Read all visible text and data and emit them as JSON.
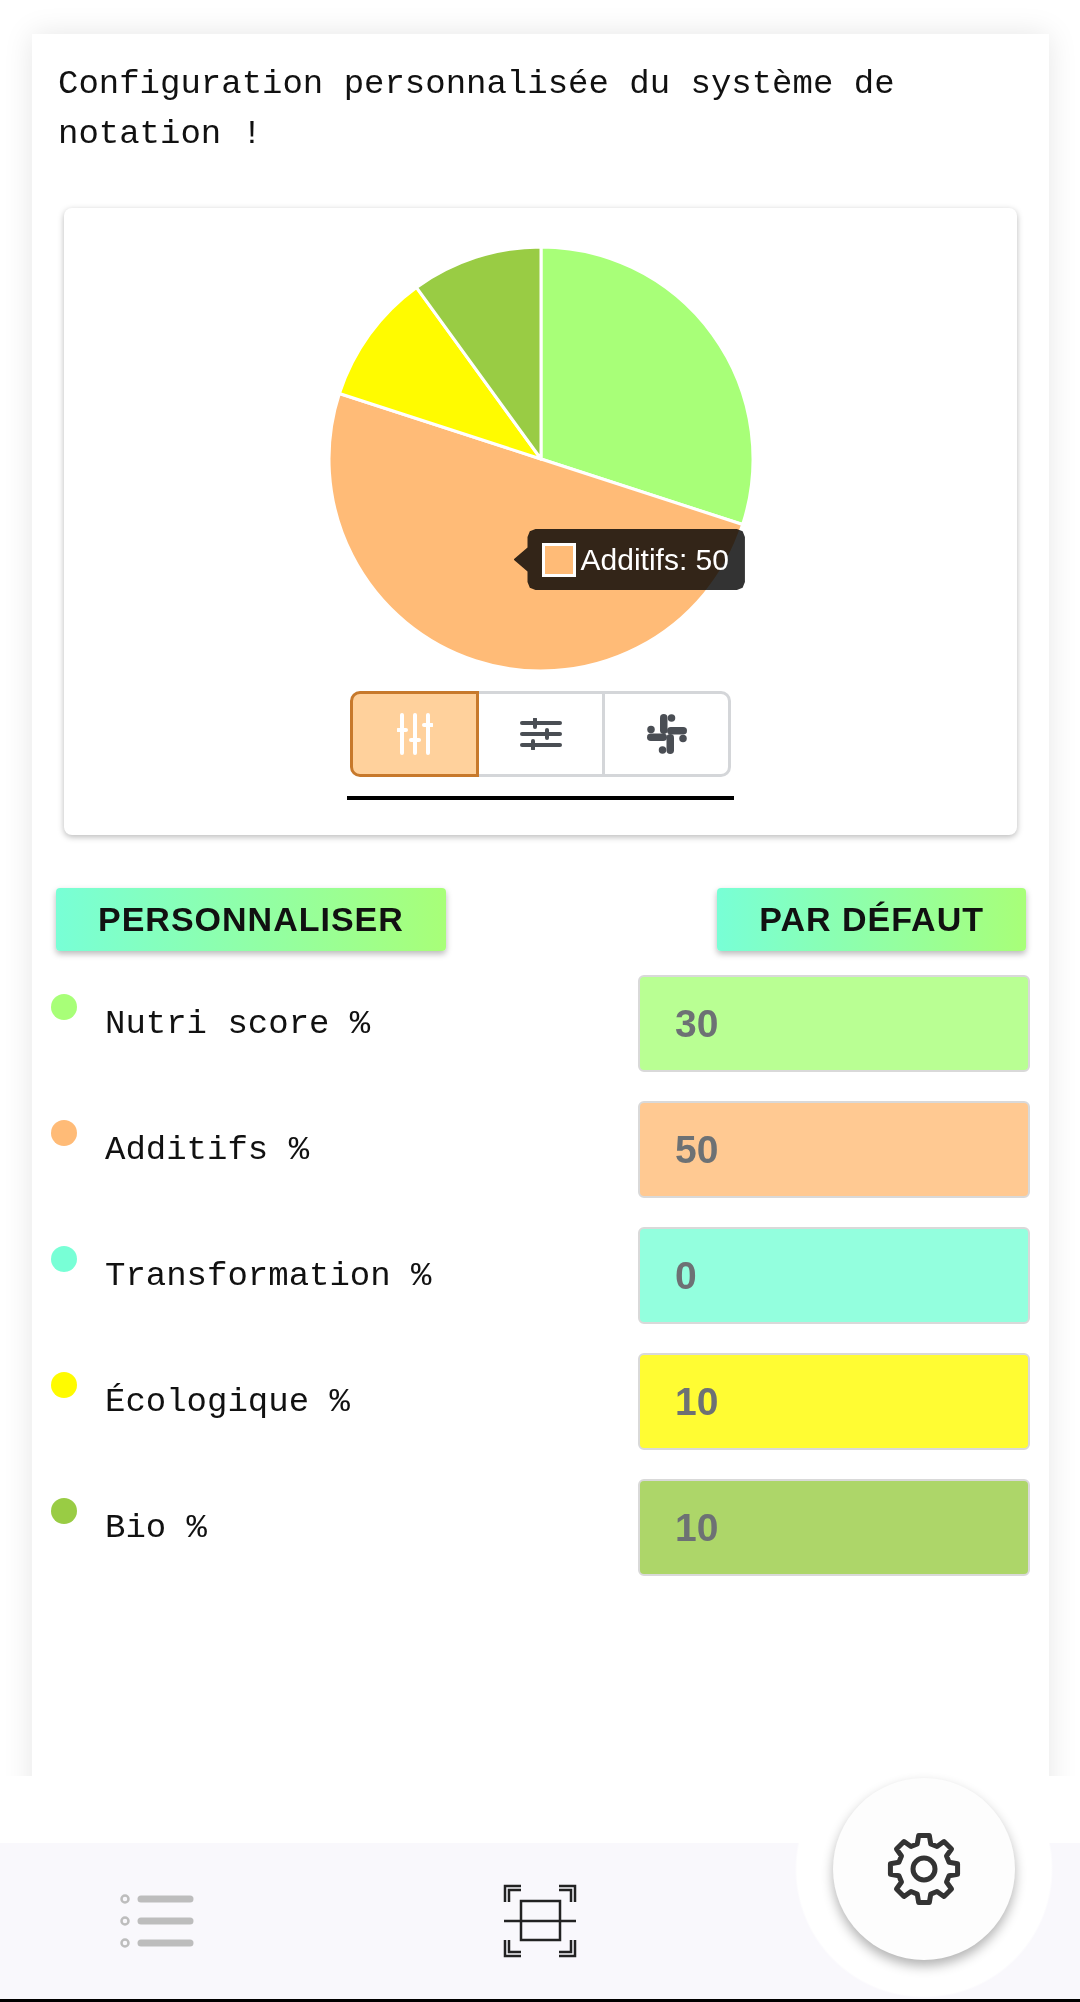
{
  "title": "Configuration personnalisée du système de notation !",
  "chart": {
    "chart_data": {
      "type": "pie",
      "values": [
        30,
        50,
        0,
        10,
        10
      ]
    },
    "tooltip": {
      "text": "Additifs: 50",
      "color": "#ffbb77"
    }
  },
  "view_tabs": [
    {
      "kind": "vertical",
      "selected": true
    },
    {
      "kind": "horizontal",
      "selected": false
    },
    {
      "kind": "hash",
      "selected": false
    }
  ],
  "actions": [
    "PERSONNALISER",
    "PAR DÉFAUT"
  ],
  "rows": [
    {
      "label": "Nutri score %",
      "color": "#a8ff78",
      "value": "30"
    },
    {
      "label": "Additifs %",
      "color": "#ffbb77",
      "value": "50"
    },
    {
      "label": "Transformation %",
      "color": "#78ffd6",
      "value": "0"
    },
    {
      "label": "Écologique %",
      "color": "#fffb00",
      "value": "10"
    },
    {
      "label": "Bio %",
      "color": "#99cc44",
      "value": "10"
    }
  ]
}
